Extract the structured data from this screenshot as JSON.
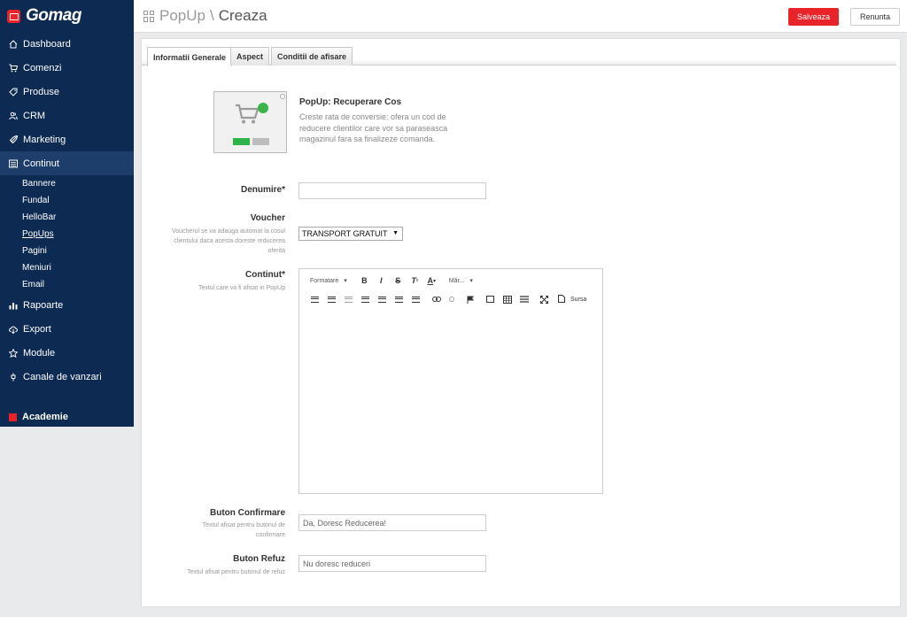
{
  "app": {
    "name": "Gomag"
  },
  "sidebar": {
    "items": [
      {
        "label": "Dashboard",
        "icon": "home-icon"
      },
      {
        "label": "Comenzi",
        "icon": "cart-icon"
      },
      {
        "label": "Produse",
        "icon": "tag-icon"
      },
      {
        "label": "CRM",
        "icon": "users-icon"
      },
      {
        "label": "Marketing",
        "icon": "rocket-icon"
      },
      {
        "label": "Continut",
        "icon": "list-icon",
        "active": true
      }
    ],
    "subitems": [
      "Bannere",
      "Fundal",
      "HelloBar",
      "PopUps",
      "Pagini",
      "Meniuri",
      "Email"
    ],
    "items2": [
      {
        "label": "Rapoarte",
        "icon": "chart-icon"
      },
      {
        "label": "Export",
        "icon": "cloud-icon"
      },
      {
        "label": "Module",
        "icon": "star-icon"
      },
      {
        "label": "Canale de vanzari",
        "icon": "plug-icon"
      }
    ],
    "academie": "Academie"
  },
  "header": {
    "section": "PopUp",
    "separator": "\\",
    "current": "Creaza",
    "save_label": "Salveaza",
    "cancel_label": "Renunta"
  },
  "tabs": [
    "Informatii Generale",
    "Aspect",
    "Conditii de afisare"
  ],
  "popup": {
    "name": "PopUp: Recuperare Cos",
    "description": "Creste rata de conversie: ofera un cod de reducere clientilor care vor sa paraseasca magazinul fara sa finalizeze comanda."
  },
  "form": {
    "denumire": {
      "label": "Denumire*",
      "value": ""
    },
    "voucher": {
      "label": "Voucher",
      "hint": "Voucherul se va adauga automat la cosul clientului daca acesta doreste reducerea oferita",
      "selected": "TRANSPORT GRATUIT"
    },
    "continut": {
      "label": "Continut*",
      "hint": "Textul care va fi afisat in PopUp"
    },
    "buton_confirmare": {
      "label": "Buton Confirmare",
      "hint": "Textul afisat pentru butonul de confirmare",
      "value": "Da, Doresc Reducerea!"
    },
    "buton_refuz": {
      "label": "Buton Refuz",
      "hint": "Textul afisat pentru butonul de refuz",
      "value": "Nu doresc reduceri"
    }
  },
  "editor": {
    "format_label": "Formatare",
    "size_label": "Măr...",
    "source_label": "Sursa"
  }
}
